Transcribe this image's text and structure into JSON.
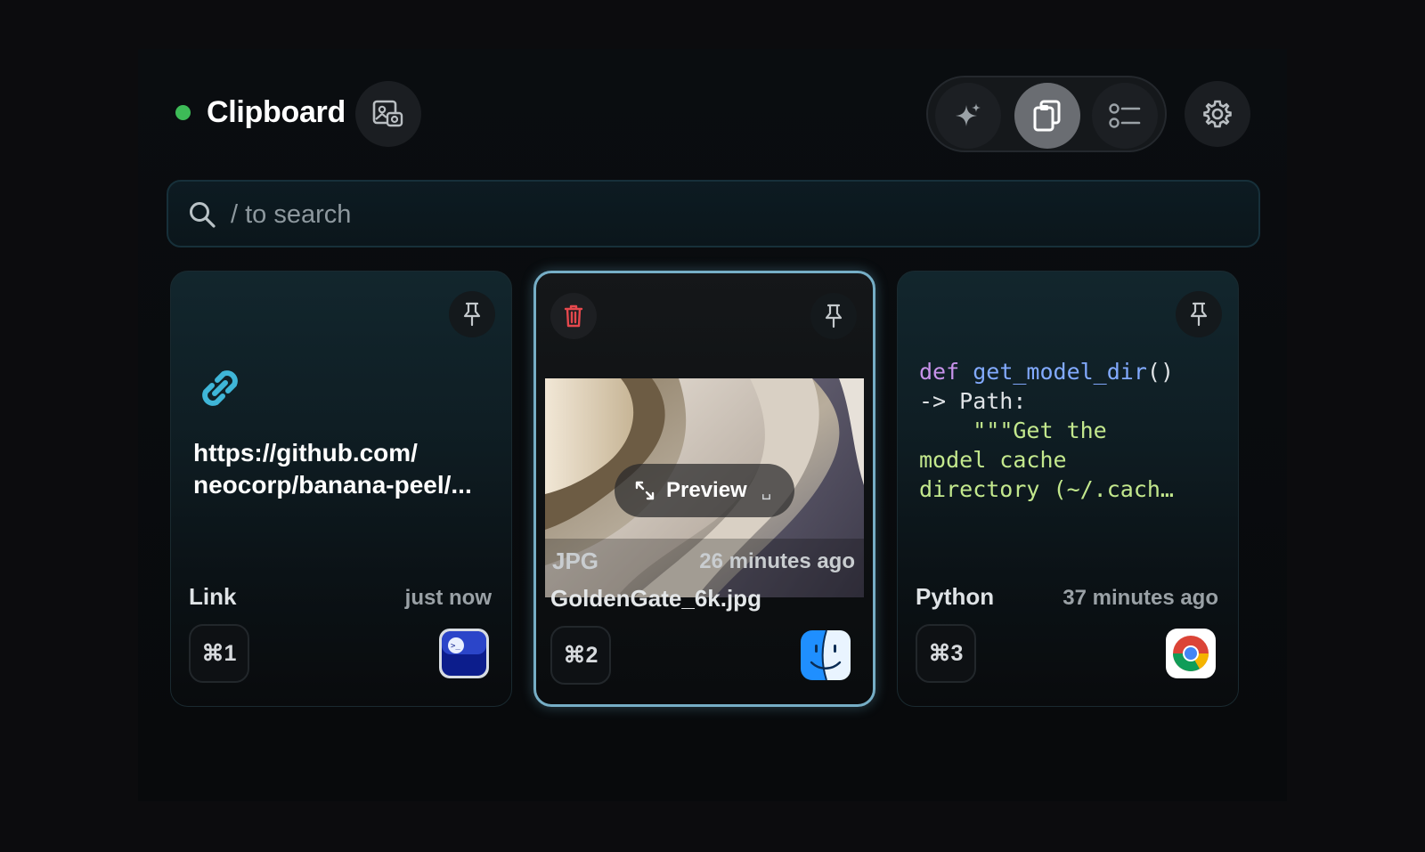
{
  "header": {
    "title": "Clipboard",
    "status": "active",
    "status_color": "#3dbb57",
    "buttons": {
      "image_capture": "image-capture-icon",
      "ai": "sparkle-icon",
      "clipboard": "clipboard-icon",
      "list": "checklist-icon",
      "settings": "gear-icon"
    },
    "active_mode": "clipboard"
  },
  "search": {
    "placeholder": "/ to search",
    "value": ""
  },
  "items": [
    {
      "type": "Link",
      "content": "https://github.com/\nneocorp/banana-peel/...",
      "time": "just now",
      "shortcut": "⌘1",
      "source_app": "terminal-app-icon",
      "icon": "link-icon"
    },
    {
      "type": "JPG",
      "time": "26 minutes ago",
      "filename": "GoldenGate_6k.jpg",
      "preview_label": "Preview",
      "preview_key": "␣",
      "shortcut": "⌘2",
      "source_app": "finder-app-icon",
      "selected": true
    },
    {
      "type": "Python",
      "code_tokens": {
        "kw": "def",
        "fn": "get_model_dir",
        "paren": "()",
        "arrow": "-> Path:",
        "doc1": "\"\"\"Get the",
        "doc2": "model cache",
        "doc3": "directory (~/.cach…"
      },
      "time": "37 minutes ago",
      "shortcut": "⌘3",
      "source_app": "chrome-app-icon"
    }
  ],
  "colors": {
    "accent_border": "#76aec6",
    "link_icon": "#3fb6d8",
    "delete_icon": "#e5484d"
  }
}
